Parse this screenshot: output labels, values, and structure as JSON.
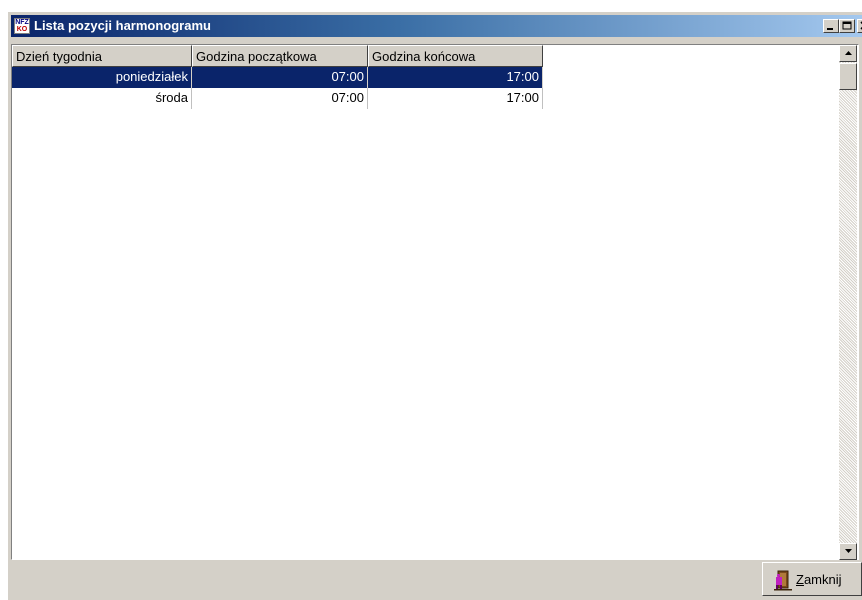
{
  "window": {
    "title": "Lista pozycji harmonogramu",
    "icon_text_top": "NFZ",
    "icon_text_bottom": "KO"
  },
  "grid": {
    "columns": [
      "Dzień tygodnia",
      "Godzina początkowa",
      "Godzina końcowa"
    ],
    "rows": [
      {
        "day": "poniedziałek",
        "start": "07:00",
        "end": "17:00",
        "selected": true
      },
      {
        "day": "środa",
        "start": "07:00",
        "end": "17:00",
        "selected": false
      }
    ]
  },
  "footer": {
    "close_button_mnemonic": "Z",
    "close_button_rest": "amknij"
  },
  "colors": {
    "title_bar_start": "#0a246a",
    "title_bar_end": "#a6caf0",
    "selection": "#0a246a",
    "face": "#d4d0c8"
  },
  "icons": [
    "app-icon",
    "minimize-icon",
    "maximize-icon",
    "close-icon",
    "scroll-up-arrow-icon",
    "scroll-down-arrow-icon",
    "door-exit-icon"
  ]
}
